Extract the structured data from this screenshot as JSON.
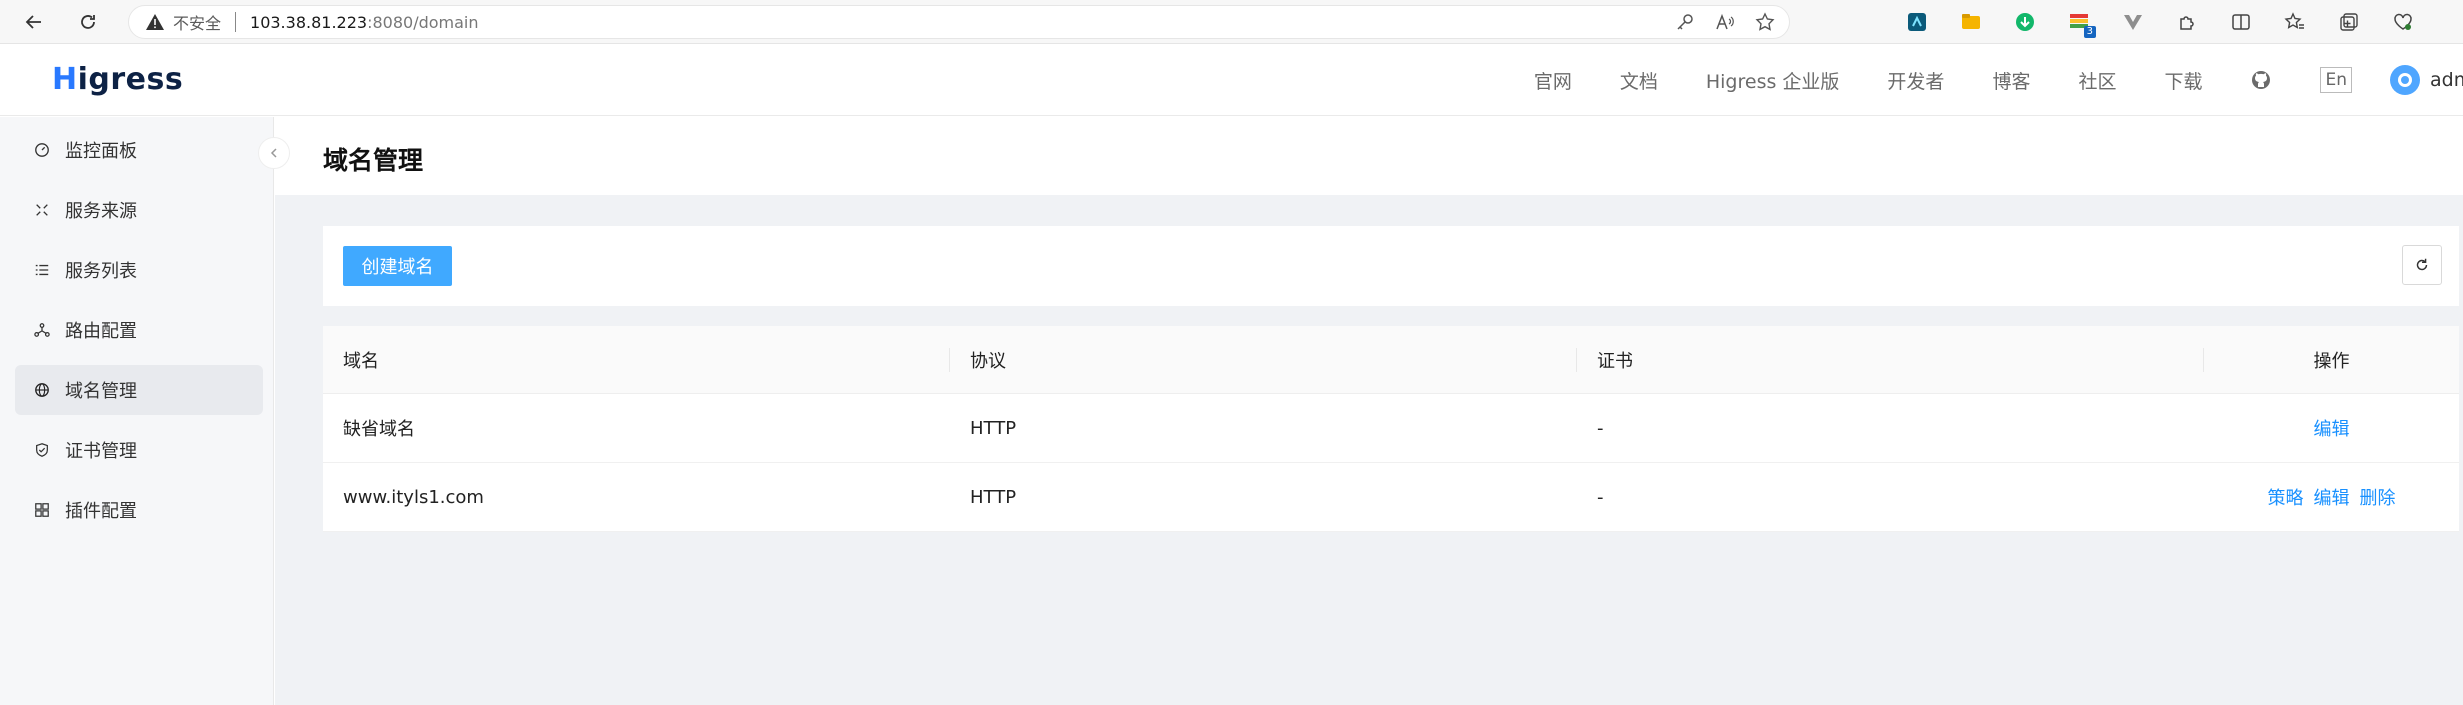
{
  "browser": {
    "insecure_label": "不安全",
    "url_host": "103.38.81.223",
    "url_rest": ":8080/domain",
    "extension_badge": "3"
  },
  "header": {
    "logo": "Higress",
    "logo_first": "H",
    "logo_rest": "igress",
    "nav": [
      "官网",
      "文档",
      "Higress 企业版",
      "开发者",
      "博客",
      "社区",
      "下载"
    ],
    "lang": "En",
    "user": "admin"
  },
  "sidebar": {
    "items": [
      {
        "label": "监控面板",
        "icon": "dashboard-icon"
      },
      {
        "label": "服务来源",
        "icon": "service-source-icon"
      },
      {
        "label": "服务列表",
        "icon": "list-icon"
      },
      {
        "label": "路由配置",
        "icon": "route-icon"
      },
      {
        "label": "域名管理",
        "icon": "globe-icon",
        "active": true
      },
      {
        "label": "证书管理",
        "icon": "shield-icon"
      },
      {
        "label": "插件配置",
        "icon": "plugin-icon"
      }
    ]
  },
  "page": {
    "title": "域名管理",
    "create_button": "创建域名"
  },
  "table": {
    "columns": [
      "域名",
      "协议",
      "证书",
      "操作"
    ],
    "rows": [
      {
        "domain": "缺省域名",
        "protocol": "HTTP",
        "cert": "-",
        "actions": [
          "编辑"
        ]
      },
      {
        "domain": "www.ityls1.com",
        "protocol": "HTTP",
        "cert": "-",
        "actions": [
          "策略",
          "编辑",
          "删除"
        ]
      }
    ]
  },
  "colors": {
    "accent": "#40a9ff",
    "link": "#1890ff",
    "background": "#f0f2f5"
  }
}
